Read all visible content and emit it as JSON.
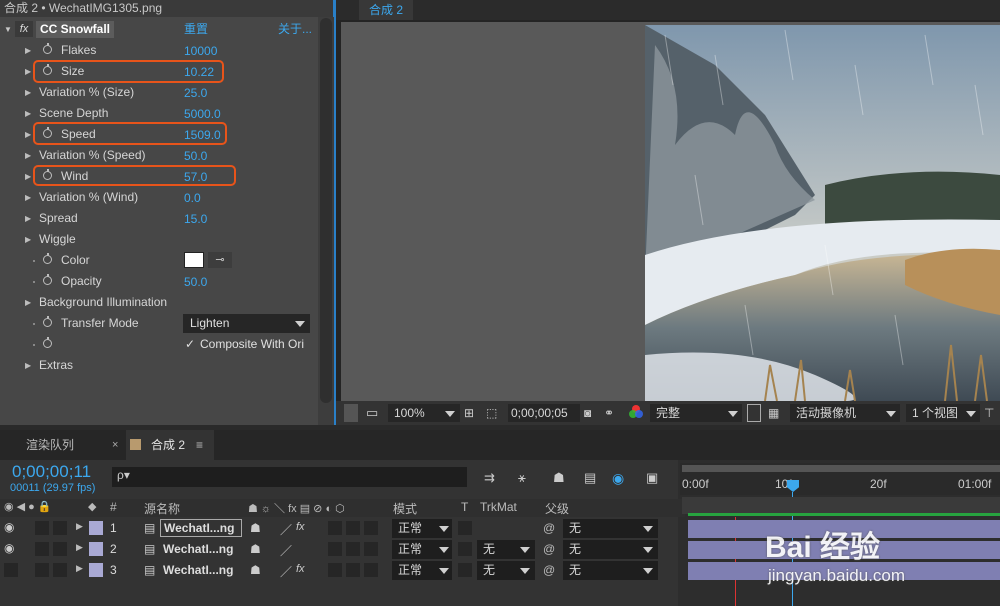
{
  "effects_panel": {
    "header": "合成 2 • WechatIMG1305.png",
    "effect_name": "CC Snowfall",
    "fx": "fx",
    "reset": "重置",
    "about": "关于...",
    "params": [
      {
        "label": "Flakes",
        "value": "10000"
      },
      {
        "label": "Size",
        "value": "10.22"
      },
      {
        "label": "Variation % (Size)",
        "value": "25.0"
      },
      {
        "label": "Scene Depth",
        "value": "5000.0"
      },
      {
        "label": "Speed",
        "value": "1509.0"
      },
      {
        "label": "Variation % (Speed)",
        "value": "50.0"
      },
      {
        "label": "Wind",
        "value": "57.0"
      },
      {
        "label": "Variation % (Wind)",
        "value": "0.0"
      },
      {
        "label": "Spread",
        "value": "15.0"
      },
      {
        "label": "Wiggle",
        "value": ""
      },
      {
        "label": "Color",
        "value": ""
      },
      {
        "label": "Opacity",
        "value": "50.0"
      },
      {
        "label": "Background Illumination",
        "value": ""
      },
      {
        "label": "Transfer Mode",
        "value": "Lighten"
      },
      {
        "label": "",
        "value": "Composite With Ori"
      },
      {
        "label": "Extras",
        "value": ""
      }
    ],
    "checkmark": "✓",
    "highlight_color": "#e8541a",
    "value_color": "#3ca8ee"
  },
  "viewer": {
    "tab": "合成 2",
    "zoom": "100%",
    "timecode": "0;00;00;05",
    "resolution": "完整",
    "camera": "活动摄像机",
    "views": "1 个视图"
  },
  "timeline": {
    "tab_render": "渲染队列",
    "tab_comp": "合成 2",
    "timecode": "0;00;00;11",
    "frame_info": "00011 (29.97 fps)",
    "search_placeholder": "",
    "columns": {
      "num": "#",
      "source": "源名称",
      "mode": "模式",
      "t": "T",
      "trkmat": "TrkMat",
      "parent": "父级"
    },
    "ruler": [
      "0:00f",
      "10f",
      "20f",
      "01:00f"
    ],
    "layers": [
      {
        "num": "1",
        "name": "WechatI...ng",
        "mode": "正常",
        "trkmat": "",
        "parent": "无"
      },
      {
        "num": "2",
        "name": "WechatI...ng",
        "mode": "正常",
        "trkmat": "无",
        "parent": "无"
      },
      {
        "num": "3",
        "name": "WechatI...ng",
        "mode": "正常",
        "trkmat": "无",
        "parent": "无"
      }
    ]
  },
  "watermark": {
    "text": "Bai 经验",
    "url": "jingyan.baidu.com"
  }
}
